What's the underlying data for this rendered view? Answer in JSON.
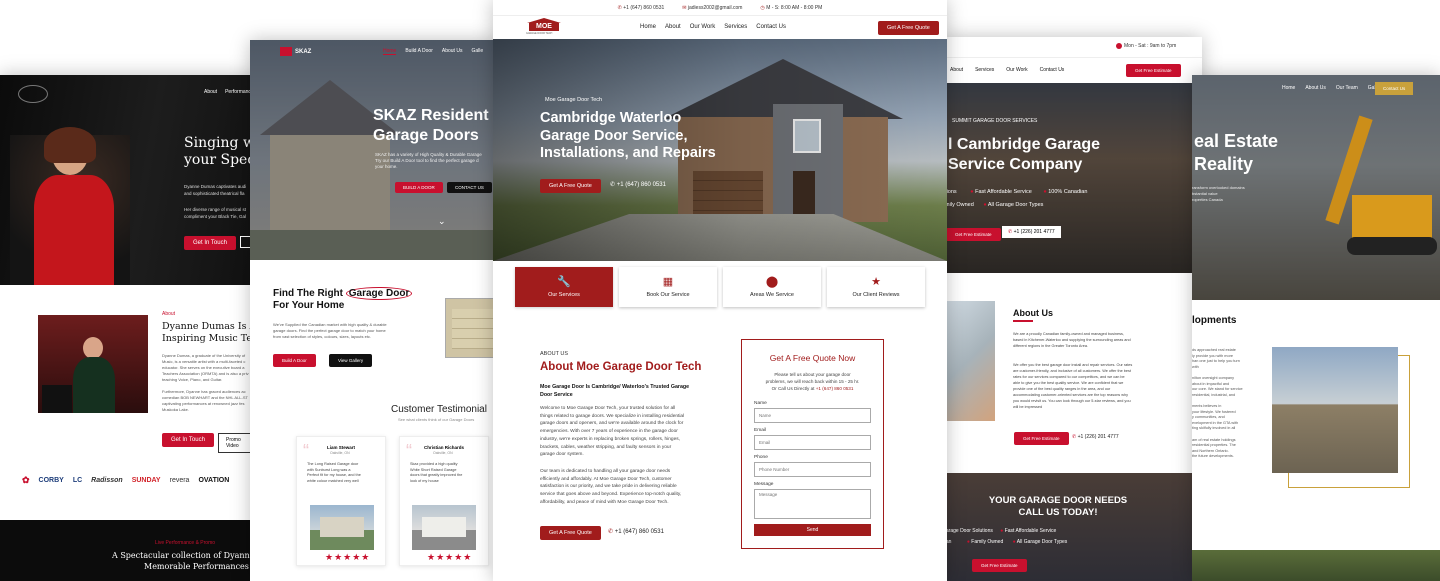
{
  "p1": {
    "nav": [
      "About",
      "Performances"
    ],
    "hero_title": "Singing with\nyour Special",
    "hero_p1": "Dyanne Dumas captivates audi\nand sophisticated theatrical fla",
    "hero_p2": "Her diverse range of musical st\ncompliment your Black Tie, Gal",
    "hero_btn": "Get In Touch",
    "about_label": "About",
    "about_title": "Dyanne Dumas Is A Ta\nInspiring Music Teache",
    "about_p1": "Dyanne Dumas, a graduate of the University of\nMusic, is a versatile artist with a multi-faceted c\neducator. She serves on the executive board a\nTeachers Association (ORMTA) and is also a priv\nteaching Voice, Piano, and Guitar.",
    "about_p2": "Furthermore, Dyanne has graced audiences ac\ncomedian BOB NEWHART and the NHL ALL-ST\ncaptivating performances at renowned jazz fes\nMuskoka Lake.",
    "btn_touch": "Get In Touch",
    "btn_video": "Promo Video",
    "logos": [
      "CORBY",
      "Radisson",
      "SUNDAY",
      "revera",
      "OVATION"
    ],
    "footer_label": "Live Performance & Promo",
    "footer_title": "A Spectacular collection of Dyanne Duma\nMemorable Performances"
  },
  "p2": {
    "logo": "SKAZ",
    "nav": [
      "Home",
      "Build A Door",
      "About Us",
      "Galle"
    ],
    "hero_title": "SKAZ Resident\nGarage Doors",
    "hero_p": "SKAZ has a variety of High Quality & Durable Garage\nTry our Build A Door tool to find the perfect garage d\nyour home.",
    "btn_build": "BUILD A DOOR",
    "btn_contact": "CONTACT US",
    "find_pre": "Find The Right ",
    "find_hl": "Garage Door",
    "find_post": "For Your Home",
    "find_p": "We've Supplied the Canadian market with high quality & durable\ngarage doors. Find the perfect garage door to match your home\nfrom vast selection of styles, colours, sizes, layouts etc.",
    "btn_door": "Build A Door",
    "btn_gallery": "View Gallery",
    "testi_title": "Customer Testimonial",
    "testi_sub": "See what clients think of our Garage Doors",
    "t1_name": "Liam Stewart",
    "t1_loc": "Oakville, ON",
    "t1_text": "The Long Raised Garage door\nwith Sunburst Long was a\nPerfect fit for my house, and the\nwhite colour matched very well",
    "t2_name": "Christian Richards",
    "t2_loc": "Oakville, ON",
    "t2_text": "Skaz provided a high quality\nWhite Short Raised Garage\ndoors that greatly improved the\nlook of my house",
    "stars": "★★★★★"
  },
  "p3": {
    "phone_top": "+1 (647) 860 0531",
    "email_top": "jadiess2002@gmail.com",
    "hours_top": "M - S: 8:00 AM - 8:00 PM",
    "logo": "MOE",
    "logo_sub": "GARAGE DOOR TECH",
    "nav": [
      "Home",
      "About",
      "Our Work",
      "Services",
      "Contact Us"
    ],
    "quote_btn": "Get A Free Quote",
    "hero_small": "Moe Garage Door Tech",
    "hero_title": "Cambridge Waterloo\nGarage Door Service,\nInstallations, and Repairs",
    "hero_btn": "Get A Free Quote",
    "hero_phone": "+1 (647) 860 0531",
    "tabs": [
      "Our Services",
      "Book Our Service",
      "Areas We Service",
      "Our Client Reviews"
    ],
    "about_label": "ABOUT US",
    "about_title": "About Moe Garage Door Tech",
    "about_sub": "Moe Garage Door Is Cambridge/ Waterloo's Trusted Garage\nDoor Service",
    "about_p1": "Welcome to Moe Garage Door Tech, your trusted solution for all\nthings related to garage doors. We specialize in installing residential\ngarage doors and openers, and we're available around the clock for\nemergencies. With over 7 years of experience in the garage door\nindustry, we're experts in replacing broken springs, rollers, hinges,\nbrackets, cables, weather stripping, and faulty sensors in your\ngarage door system.",
    "about_p2": "Our team is dedicated to handling all your garage door needs\nefficiently and affordably. At Moe Garage Door Tech, customer\nsatisfaction is our priority, and we take pride in delivering reliable\nservice that goes above and beyond. Experience top-notch quality,\naffordability, and peace of mind with Moe Garage Door Tech.",
    "about_btn": "Get A Free Quote",
    "about_phone": "+1 (647) 860 0531",
    "form_title": "Get A Free Quote Now",
    "form_desc": "Please tell us about your garage door\nproblems, we will reach back within 15 - 25 hr.\nOr Call Us Directly at ",
    "form_phone": "+1 (647) 860 0531",
    "name_label": "Name",
    "name_ph": "Name",
    "email_label": "Email",
    "email_ph": "Email",
    "phone_label": "Phone",
    "phone_ph": "Phone Number",
    "msg_label": "Message",
    "msg_ph": "Message",
    "send": "Send"
  },
  "p4": {
    "hours": "Mon - Sat : 9am to 7pm",
    "nav": [
      "About",
      "Services",
      "Our Work",
      "Contact Us"
    ],
    "nav_btn": "Get Free Estimate",
    "hero_small": "SUMMIT GARAGE DOOR SERVICES",
    "hero_title": "l Cambridge Garage\nService Company",
    "checks": [
      "utions",
      "Fast Affordable Service",
      "100% Canadian",
      "amily Owned",
      "All Garage Door Types"
    ],
    "hero_btn": "Get Free Estimate",
    "hero_phone": "+1 (226) 201 4777",
    "about_title": "About Us",
    "about_p1": "We are a proudly Canadian family-owned and managed business,\nbased in Kitchener-Waterloo and supplying the surrounding areas and\ndifferent regions in the Greater Toronto Area.",
    "about_p2": "We offer you the best garage door install and repair services. Our rates\nare customer-friendly, and inclusive of all customers. We offer the best\nrates for our services compared to our competitors, and we can be\nable to give you the best quality service. We are confident that we\nprovide one of the best quality ranges in the area, and our\naccommodating customer-oriented services are the top reasons why\nyou would revisit us. You can look through our 5-star reviews, and you\nwill be impressed",
    "about_btn": "Get Free Estimate",
    "about_phone": "+1 (226) 201 4777",
    "cta_title": "YOUR GARAGE DOOR NEEDS\nCALL US TODAY!",
    "cta_checks": [
      "Garage Door Solutions",
      "Fast Affordable Service",
      "dian",
      "Family Owned",
      "All Garage Door Types"
    ],
    "cta_btn": "Get Free Estimate"
  },
  "p5": {
    "nav": [
      "Home",
      "About Us",
      "Our Team",
      "Gallery"
    ],
    "nav_btn": "Contact Us",
    "hero_title": "eal Estate\nReality",
    "hero_p": "ransform overlooked domains\nbstantial value\nroperties Canada",
    "dev_title": "lopments",
    "dev_text": "ds approached real estate\nly provide you with more\nhan one just to help you turn\nwith\n\nnilton oversight company\nabout in impactful and\nour core. We stand for service\nresidential, industrial, and\n\nments believes in\nyour lifestyle. We fostered\ny communities, and\nevelopment in the GTA with\nting skilfully involved in all\n\nam of real estate holdings\nresidential properties. The\nand Northern Ontario.\nthe future developments."
  }
}
